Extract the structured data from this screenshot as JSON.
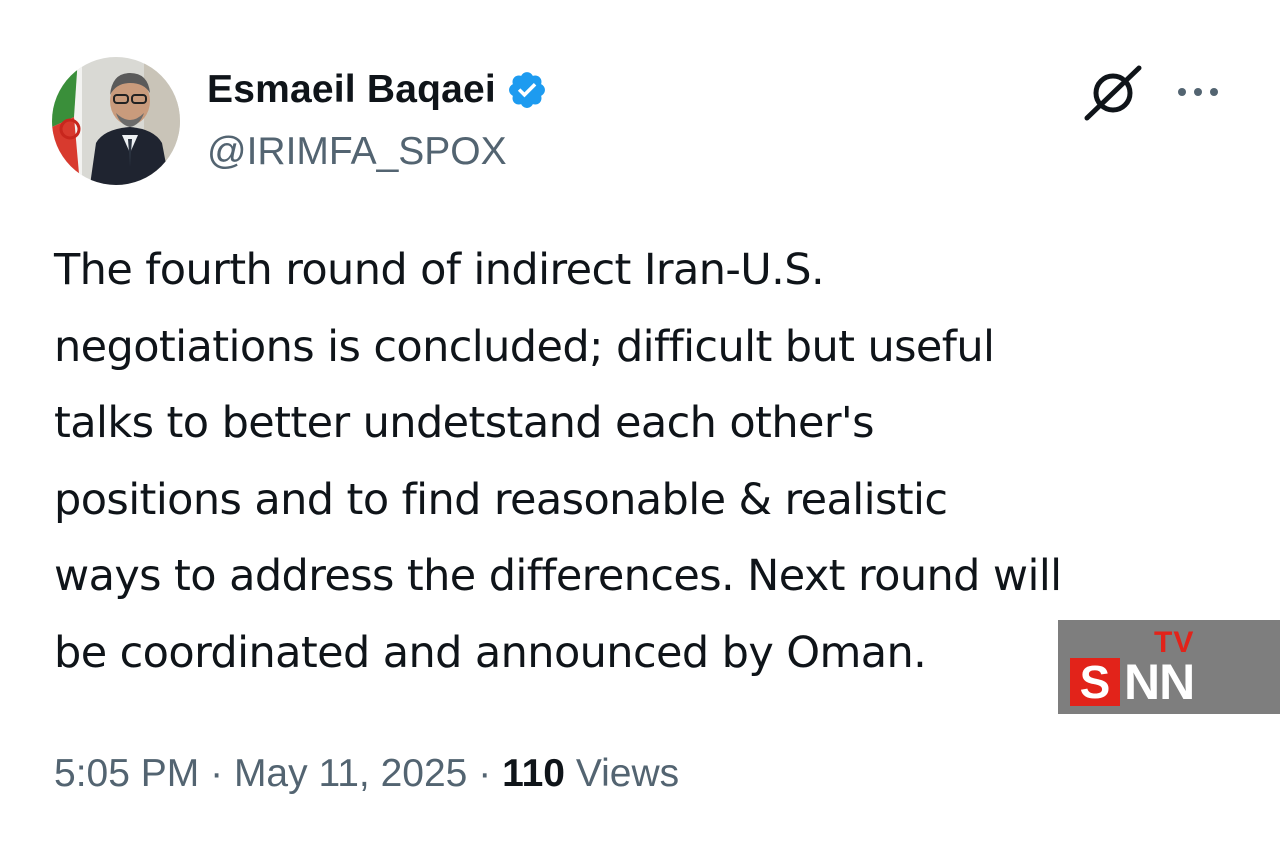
{
  "author": {
    "display_name": "Esmaeil Baqaei",
    "handle": "@IRIMFA_SPOX",
    "verified": true,
    "avatar_icon": "profile-photo"
  },
  "actions": {
    "grok_icon": "grok-icon",
    "more_icon": "more-icon"
  },
  "tweet": {
    "text": "The fourth round of indirect Iran-U.S.\nnegotiations is concluded; difficult but useful\ntalks to better undetstand each other's\npositions and to find reasonable & realistic\nways to address the differences. Next round will\nbe coordinated and announced by Oman."
  },
  "meta": {
    "time": "5:05 PM",
    "separator": "·",
    "date": "May 11, 2025",
    "views_count": "110",
    "views_label": "Views"
  },
  "watermark": {
    "tv": "TV",
    "s": "S",
    "nn": "NN"
  },
  "colors": {
    "text_primary": "#0f1419",
    "text_secondary": "#536471",
    "verified_blue": "#1d9bf0",
    "watermark_red": "#e2231a",
    "watermark_gray": "#7e7e7e"
  }
}
